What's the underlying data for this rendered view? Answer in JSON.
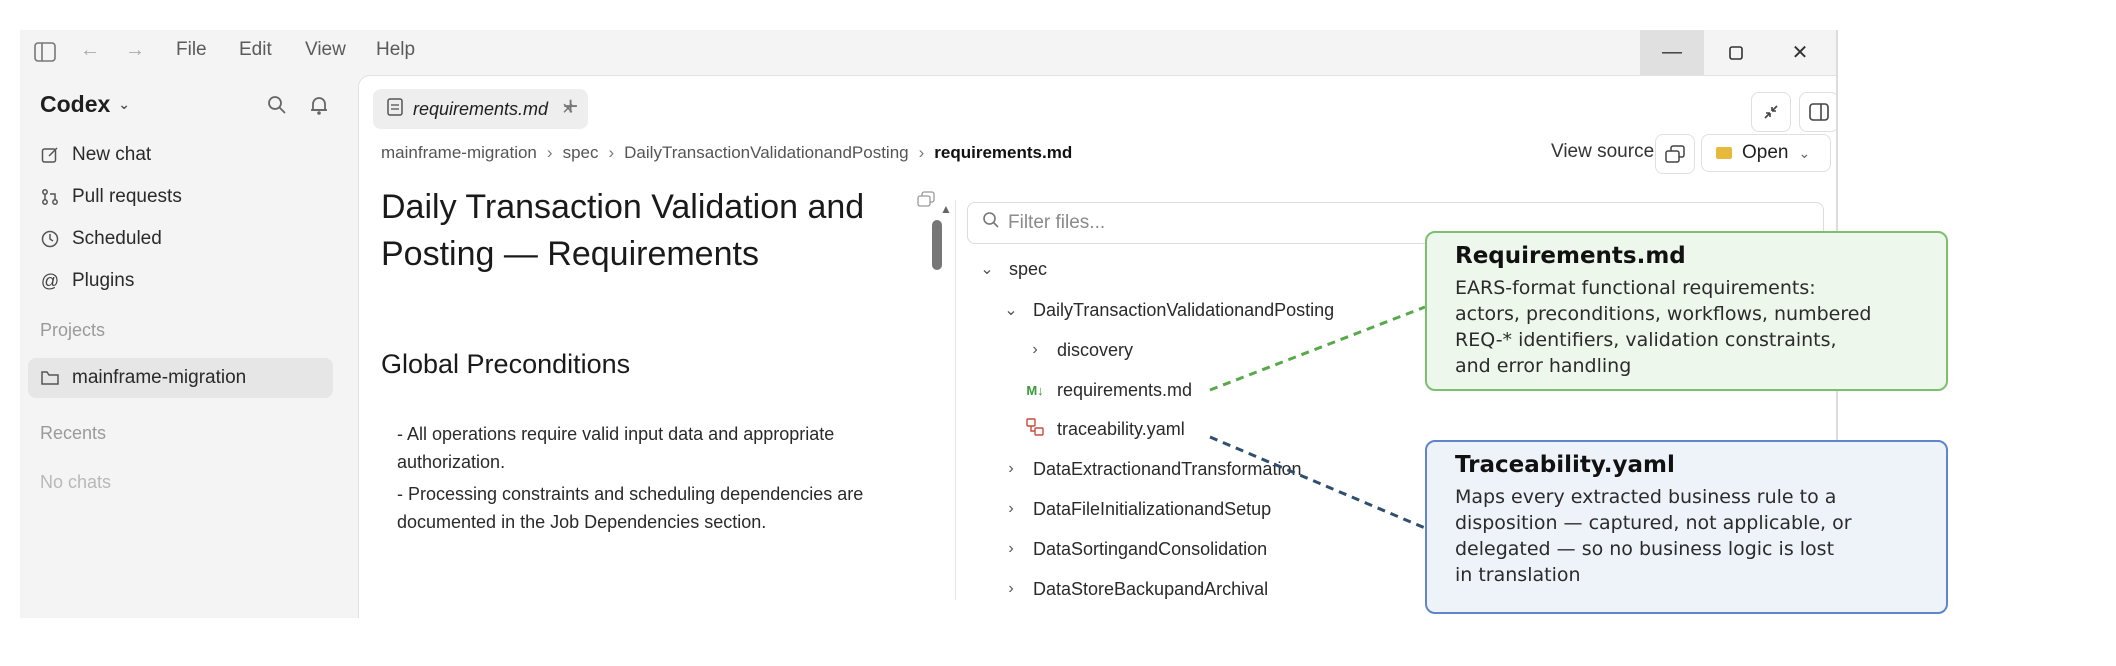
{
  "menu": {
    "items": [
      "File",
      "Edit",
      "View",
      "Help"
    ]
  },
  "sidebar": {
    "app_name": "Codex",
    "nav": [
      {
        "label": "New chat",
        "icon": "edit-icon"
      },
      {
        "label": "Pull requests",
        "icon": "pull-request-icon"
      },
      {
        "label": "Scheduled",
        "icon": "clock-icon"
      },
      {
        "label": "Plugins",
        "icon": "at-sign-icon"
      }
    ],
    "projects_label": "Projects",
    "projects": [
      {
        "label": "mainframe-migration",
        "icon": "folder-icon"
      }
    ],
    "recents_label": "Recents",
    "recents_empty": "No chats"
  },
  "tab": {
    "name": "requirements.md",
    "close": "×",
    "add": "+"
  },
  "breadcrumb": [
    "mainframe-migration",
    "spec",
    "DailyTransactionValidationandPosting",
    "requirements.md"
  ],
  "toolbar": {
    "view_source": "View source",
    "open": "Open"
  },
  "document": {
    "title": "Daily Transaction Validation and Posting — Requirements",
    "section": "Global Preconditions",
    "bullets": [
      "- All operations require valid input data and appropriate authorization.",
      "- Processing constraints and scheduling dependencies are documented in the Job Dependencies section."
    ]
  },
  "file_tree": {
    "filter_placeholder": "Filter files...",
    "rows": [
      {
        "label": "spec",
        "chevron": "down"
      },
      {
        "label": "DailyTransactionValidationandPosting",
        "chevron": "down"
      },
      {
        "label": "discovery",
        "chevron": "right"
      },
      {
        "label": "requirements.md",
        "badge": "M↓"
      },
      {
        "label": "traceability.yaml",
        "icon": "yaml-icon"
      },
      {
        "label": "DataExtractionandTransformation",
        "chevron": "right"
      },
      {
        "label": "DataFileInitializationandSetup",
        "chevron": "right"
      },
      {
        "label": "DataSortingandConsolidation",
        "chevron": "right"
      },
      {
        "label": "DataStoreBackupandArchival",
        "chevron": "right"
      }
    ]
  },
  "callouts": {
    "requirements": {
      "title": "Requirements.md",
      "desc": "EARS-format functional requirements:\nactors, preconditions, workflows, numbered\nREQ-* identifiers, validation constraints,\nand error handling",
      "bg": "#eef7ec",
      "border": "#7bbf6f",
      "line": "#5aa84c"
    },
    "traceability": {
      "title": "Traceability.yaml",
      "desc": "Maps every extracted business rule to a\ndisposition — captured, not applicable, or\ndelegated — so no business logic is lost\nin translation",
      "bg": "#eef3fa",
      "border": "#5f86c9",
      "line": "#2f4f6f"
    }
  }
}
